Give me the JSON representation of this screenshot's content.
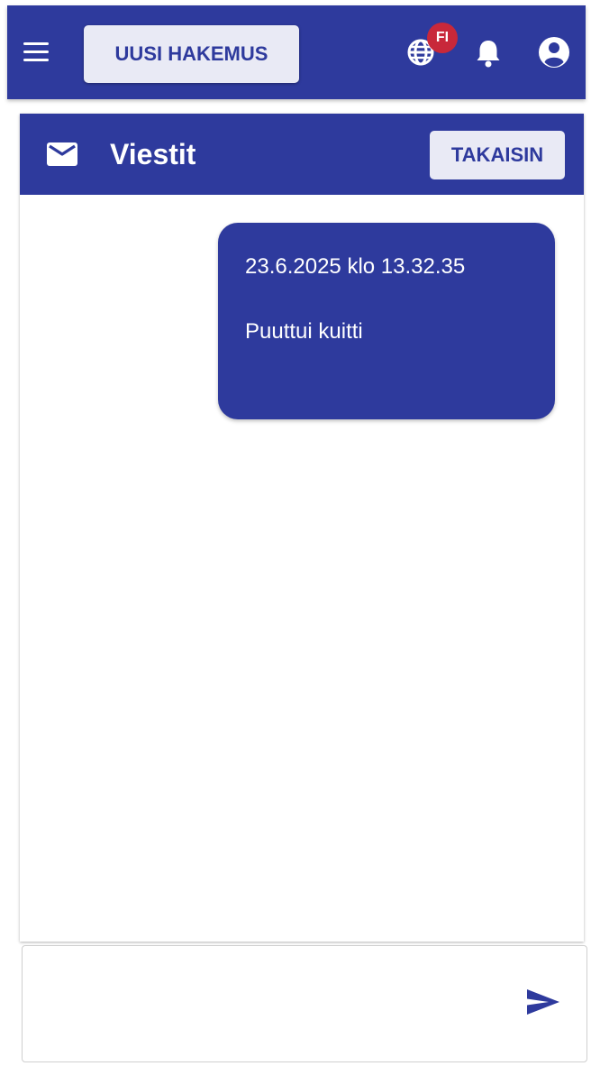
{
  "topbar": {
    "new_application_label": "UUSI HAKEMUS",
    "language_badge": "FI",
    "icons": [
      "menu-icon",
      "globe-icon",
      "bell-icon",
      "account-icon"
    ]
  },
  "messages_panel": {
    "title": "Viestit",
    "back_label": "TAKAISIN",
    "icon": "mail-icon",
    "messages": [
      {
        "timestamp": "23.6.2025 klo 13.32.35",
        "text": "Puuttui kuitti"
      }
    ]
  },
  "composer": {
    "value": "",
    "placeholder": "",
    "send_icon": "send-icon"
  },
  "colors": {
    "primary": "#2e3a9d",
    "button_bg": "#e9eaf5",
    "badge": "#c8283a",
    "background": "#ffffff"
  }
}
